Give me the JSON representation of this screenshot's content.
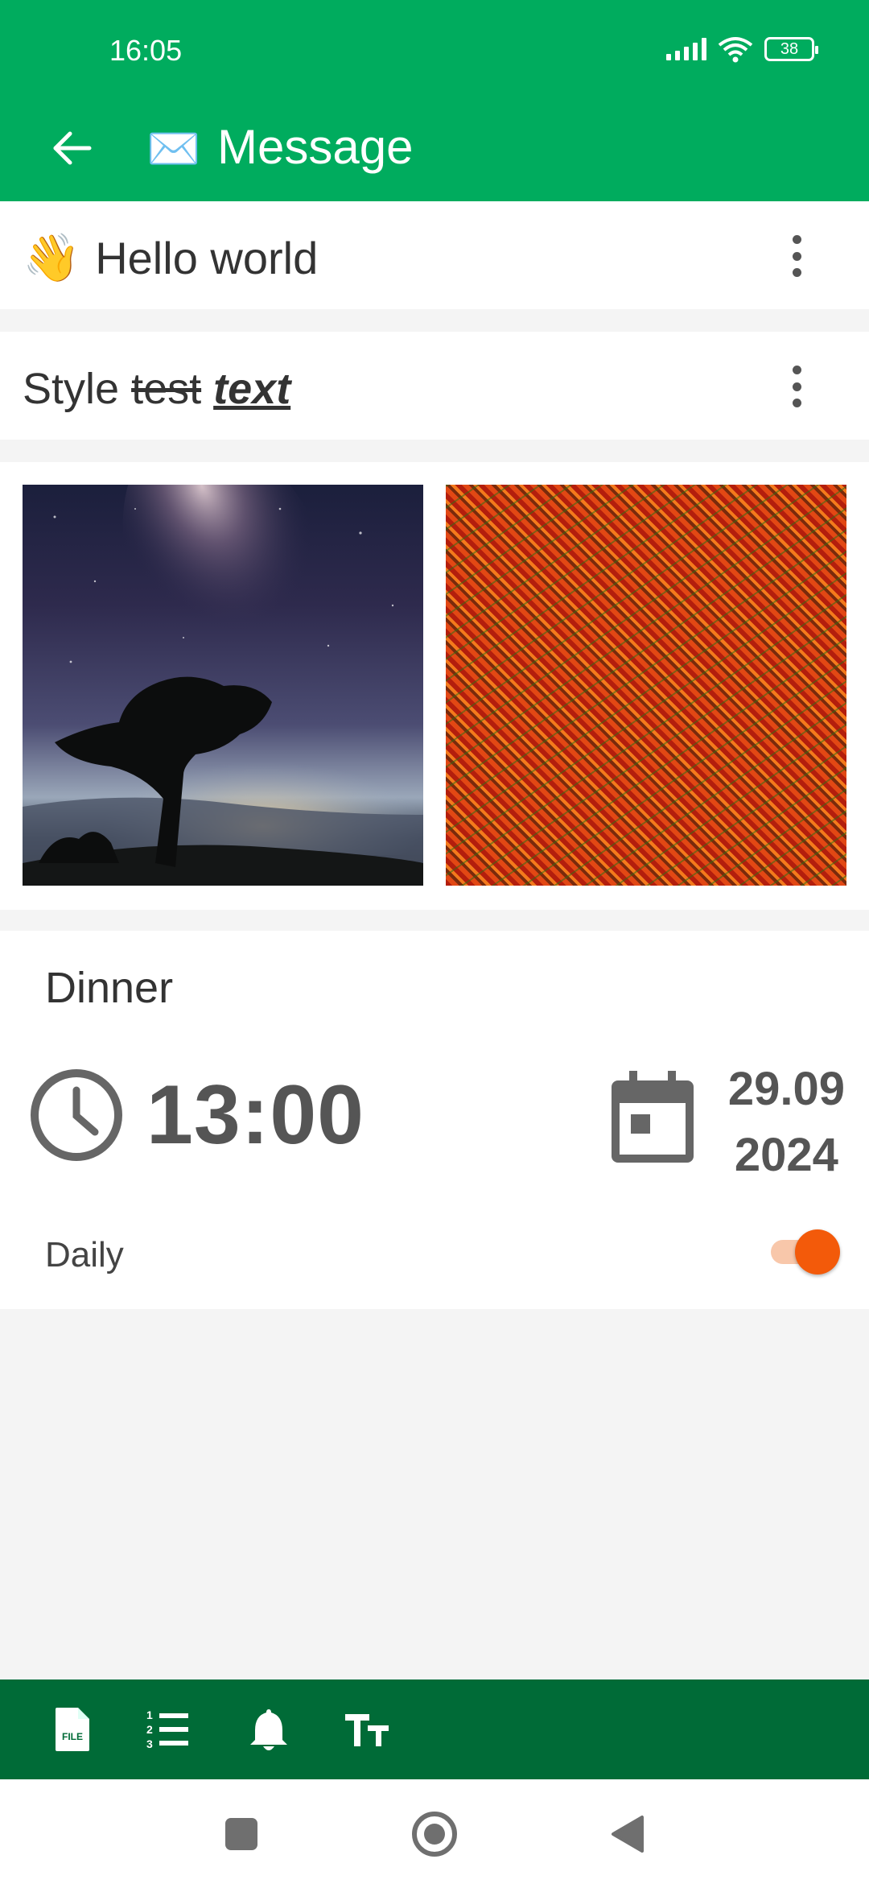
{
  "status_bar": {
    "time": "16:05",
    "battery": "38"
  },
  "app_bar": {
    "title": "Message",
    "back_icon": "arrow-back-icon",
    "title_icon": "envelope-icon"
  },
  "notes": [
    {
      "emoji": "👋",
      "text": "Hello world",
      "menu_icon": "more-vert-icon"
    },
    {
      "parts": [
        "Style",
        "test",
        "text"
      ],
      "menu_icon": "more-vert-icon"
    }
  ],
  "images": [
    {
      "description_icon": "night-sky-photo"
    },
    {
      "description_icon": "stereogram-image"
    }
  ],
  "reminder": {
    "title": "Dinner",
    "time": "13:00",
    "date_day_month": "29.09",
    "date_year": "2024",
    "repeat_label": "Daily",
    "repeat_enabled": true
  },
  "bottom_toolbar": [
    {
      "name": "file-icon",
      "label": "FILE"
    },
    {
      "name": "numbered-list-icon"
    },
    {
      "name": "bell-icon"
    },
    {
      "name": "text-size-icon"
    }
  ],
  "nav_bar": [
    "recents-square-icon",
    "home-circle-icon",
    "back-triangle-icon"
  ],
  "colors": {
    "primary": "#00ac5e",
    "primary_dark": "#006b37",
    "accent": "#f35a0a",
    "background": "#f4f4f4"
  }
}
